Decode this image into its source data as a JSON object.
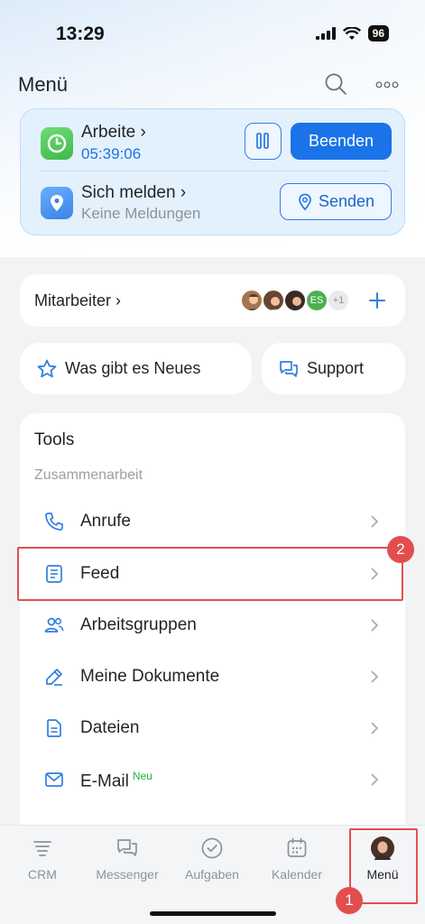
{
  "status_bar": {
    "time": "13:29",
    "battery": "96"
  },
  "header": {
    "title": "Menü"
  },
  "work_card": {
    "work": {
      "title": "Arbeite",
      "chevron": "›",
      "timer": "05:39:06",
      "end_label": "Beenden"
    },
    "report": {
      "title": "Sich melden",
      "chevron": "›",
      "subtitle": "Keine Meldungen",
      "send_label": "Senden"
    }
  },
  "staff": {
    "label": "Mitarbeiter",
    "chevron": "›",
    "avatar_initials": "ES",
    "more_count": "+1"
  },
  "quick": {
    "news_label": "Was gibt es Neues",
    "support_label": "Support"
  },
  "tools": {
    "title": "Tools",
    "section": "Zusammenarbeit",
    "items": [
      {
        "label": "Anrufe",
        "icon": "phone-icon"
      },
      {
        "label": "Feed",
        "icon": "feed-icon"
      },
      {
        "label": "Arbeitsgruppen",
        "icon": "groups-icon"
      },
      {
        "label": "Meine Dokumente",
        "icon": "pen-icon"
      },
      {
        "label": "Dateien",
        "icon": "file-icon"
      },
      {
        "label": "E-Mail",
        "icon": "mail-icon",
        "badge": "Neu"
      }
    ]
  },
  "annotations": {
    "marker_1": "1",
    "marker_2": "2"
  },
  "tabbar": {
    "tabs": [
      {
        "label": "CRM",
        "icon": "crm-icon"
      },
      {
        "label": "Messenger",
        "icon": "messenger-icon"
      },
      {
        "label": "Aufgaben",
        "icon": "tasks-icon"
      },
      {
        "label": "Kalender",
        "icon": "calendar-icon"
      },
      {
        "label": "Menü",
        "icon": "avatar",
        "active": true
      }
    ]
  },
  "colors": {
    "accent": "#1a73e8",
    "annotation": "#e24e4e",
    "new_badge": "#20b040",
    "timer": "#1a73e8"
  }
}
